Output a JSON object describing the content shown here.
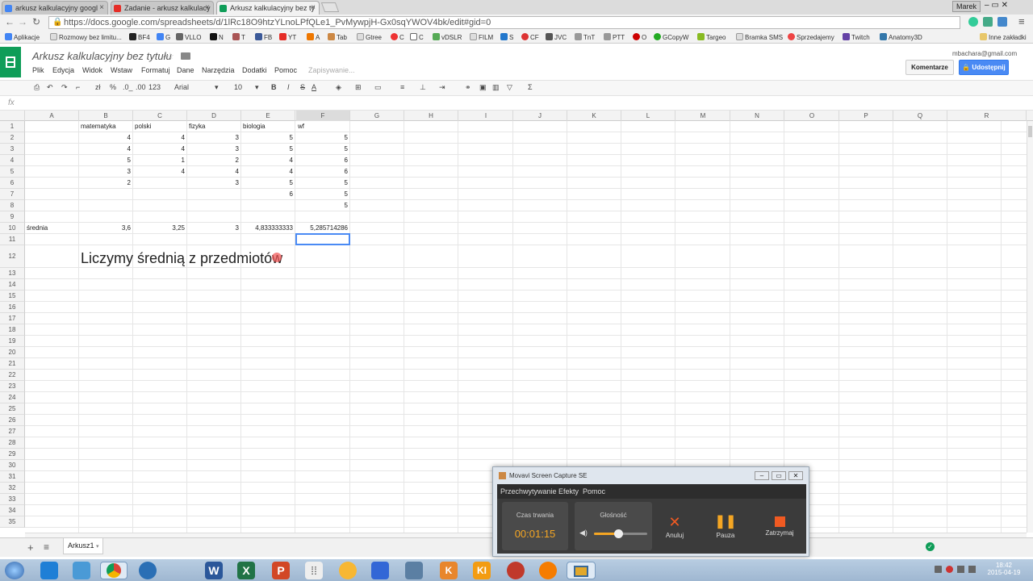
{
  "browser": {
    "tabs": [
      {
        "label": "arkusz kalkulacyjny googl",
        "color": "#4285f4"
      },
      {
        "label": "Zadanie - arkusz kalkulacy",
        "color": "#e52d27"
      },
      {
        "label": "Arkusz kalkulacyjny bez ty",
        "color": "#0f9d58"
      }
    ],
    "user_name": "Marek",
    "url": "https://docs.google.com/spreadsheets/d/1lRc18O9htzYLnoLPfQLe1_PvMywpjH-Gx0sqYWOV4bk/edit#gid=0",
    "bookmarks": [
      "Aplikacje",
      "Rozmowy bez limitu...",
      "BF4",
      "G",
      "VLLO",
      "N",
      "T",
      "FB",
      "YT",
      "A",
      "Tab",
      "Gtree",
      "C",
      "C",
      "vDSLR",
      "FILM",
      "S",
      "CF",
      "JVC",
      "TnT",
      "PTT",
      "O",
      "GCopyW",
      "Targeo",
      "Bramka SMS",
      "Sprzedajemy",
      "Twitch",
      "Anatomy3D"
    ],
    "other_bookmarks": "Inne zakładki"
  },
  "sheets": {
    "title": "Arkusz kalkulacyjny bez tytułu",
    "menu": [
      "Plik",
      "Edycja",
      "Widok",
      "Wstaw",
      "Formatuj",
      "Dane",
      "Narzędzia",
      "Dodatki",
      "Pomoc"
    ],
    "saving": "Zapisywanie...",
    "user_email": "mbachara@gmail.com",
    "comments_button": "Komentarze",
    "share_button": "Udostępnij",
    "toolbar": {
      "zl": "zł",
      "pct": "%",
      "dec1": ".0_",
      "dec2": ".00",
      "fmt": "123",
      "font": "Arial",
      "size": "10",
      "bold": "B",
      "italic": "I",
      "strike": "S",
      "underA": "A",
      "sigma": "Σ"
    },
    "fx_label": "fx",
    "columns": [
      "A",
      "B",
      "C",
      "D",
      "E",
      "F",
      "G",
      "H",
      "I",
      "J",
      "K",
      "L",
      "M",
      "N",
      "O",
      "P",
      "Q",
      "R"
    ],
    "rows": [
      "1",
      "2",
      "3",
      "4",
      "5",
      "6",
      "7",
      "8",
      "9",
      "10",
      "11",
      "12",
      "13",
      "14",
      "15",
      "16",
      "17",
      "18",
      "19",
      "20",
      "21",
      "22",
      "23",
      "24",
      "25",
      "26",
      "27",
      "28",
      "29",
      "30",
      "31",
      "32",
      "33",
      "34",
      "35"
    ],
    "cells": [
      {
        "r": 1,
        "c": "B",
        "v": "matematyka",
        "t": "s"
      },
      {
        "r": 1,
        "c": "C",
        "v": "polski",
        "t": "s"
      },
      {
        "r": 1,
        "c": "D",
        "v": "fizyka",
        "t": "s"
      },
      {
        "r": 1,
        "c": "E",
        "v": "biologia",
        "t": "s"
      },
      {
        "r": 1,
        "c": "F",
        "v": "wf",
        "t": "s"
      },
      {
        "r": 2,
        "c": "B",
        "v": "4",
        "t": "n"
      },
      {
        "r": 2,
        "c": "C",
        "v": "4",
        "t": "n"
      },
      {
        "r": 2,
        "c": "D",
        "v": "3",
        "t": "n"
      },
      {
        "r": 2,
        "c": "E",
        "v": "5",
        "t": "n"
      },
      {
        "r": 2,
        "c": "F",
        "v": "5",
        "t": "n"
      },
      {
        "r": 3,
        "c": "B",
        "v": "4",
        "t": "n"
      },
      {
        "r": 3,
        "c": "C",
        "v": "4",
        "t": "n"
      },
      {
        "r": 3,
        "c": "D",
        "v": "3",
        "t": "n"
      },
      {
        "r": 3,
        "c": "E",
        "v": "5",
        "t": "n"
      },
      {
        "r": 3,
        "c": "F",
        "v": "5",
        "t": "n"
      },
      {
        "r": 4,
        "c": "B",
        "v": "5",
        "t": "n"
      },
      {
        "r": 4,
        "c": "C",
        "v": "1",
        "t": "n"
      },
      {
        "r": 4,
        "c": "D",
        "v": "2",
        "t": "n"
      },
      {
        "r": 4,
        "c": "E",
        "v": "4",
        "t": "n"
      },
      {
        "r": 4,
        "c": "F",
        "v": "6",
        "t": "n"
      },
      {
        "r": 5,
        "c": "B",
        "v": "3",
        "t": "n"
      },
      {
        "r": 5,
        "c": "C",
        "v": "4",
        "t": "n"
      },
      {
        "r": 5,
        "c": "D",
        "v": "4",
        "t": "n"
      },
      {
        "r": 5,
        "c": "E",
        "v": "4",
        "t": "n"
      },
      {
        "r": 5,
        "c": "F",
        "v": "6",
        "t": "n"
      },
      {
        "r": 6,
        "c": "B",
        "v": "2",
        "t": "n"
      },
      {
        "r": 6,
        "c": "D",
        "v": "3",
        "t": "n"
      },
      {
        "r": 6,
        "c": "E",
        "v": "5",
        "t": "n"
      },
      {
        "r": 6,
        "c": "F",
        "v": "5",
        "t": "n"
      },
      {
        "r": 7,
        "c": "E",
        "v": "6",
        "t": "n"
      },
      {
        "r": 7,
        "c": "F",
        "v": "5",
        "t": "n"
      },
      {
        "r": 8,
        "c": "F",
        "v": "5",
        "t": "n"
      },
      {
        "r": 10,
        "c": "A",
        "v": "średnia",
        "t": "s"
      },
      {
        "r": 10,
        "c": "B",
        "v": "3,6",
        "t": "n"
      },
      {
        "r": 10,
        "c": "C",
        "v": "3,25",
        "t": "n"
      },
      {
        "r": 10,
        "c": "D",
        "v": "3",
        "t": "n"
      },
      {
        "r": 10,
        "c": "E",
        "v": "4,833333333",
        "t": "n"
      },
      {
        "r": 10,
        "c": "F",
        "v": "5,285714286",
        "t": "n"
      }
    ],
    "overlay_text": "Liczymy średnią z przedmiotów",
    "sheet_tab": "Arkusz1"
  },
  "movavi": {
    "title": "Movavi Screen Capture SE",
    "menu": [
      "Przechwytywanie",
      "Efekty",
      "Pomoc"
    ],
    "duration_label": "Czas trwania",
    "duration": "00:01:15",
    "volume_label": "Głośność",
    "volume_level": 0.45,
    "cancel": "Anuluj",
    "pause": "Pauza",
    "stop": "Zatrzymaj"
  },
  "taskbar": {
    "time": "18:42",
    "date": "2015-04-19"
  }
}
